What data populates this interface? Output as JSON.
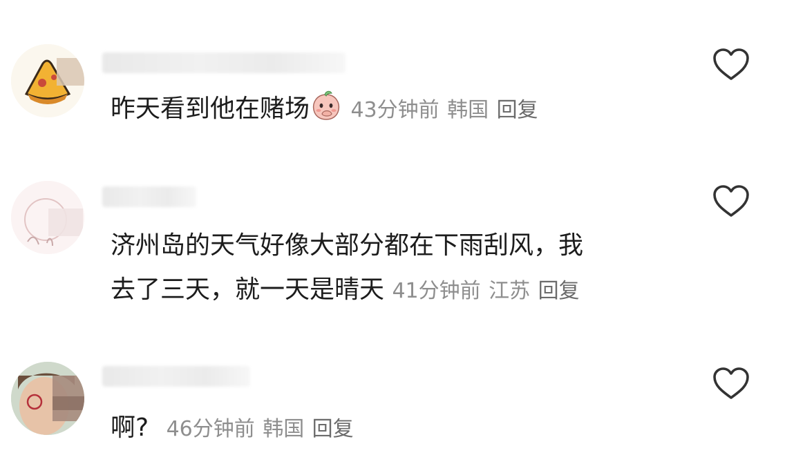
{
  "comments": [
    {
      "text": "昨天看到他在赌场",
      "emoji": "peach-covering-mouth-emoji",
      "time": "43分钟前",
      "location": "韩国",
      "reply_label": "回复",
      "like_icon": "heart-outline-icon"
    },
    {
      "text_line1": "济州岛的天气好像大部分都在下雨刮风，我",
      "text_line2": "去了三天，就一天是晴天",
      "time": "41分钟前",
      "location": "江苏",
      "reply_label": "回复",
      "like_icon": "heart-outline-icon"
    },
    {
      "text": "啊?",
      "time": "46分钟前",
      "location": "韩国",
      "reply_label": "回复",
      "like_icon": "heart-outline-icon"
    }
  ],
  "colors": {
    "text": "#1c1c1c",
    "meta": "#8e8e8e",
    "icon": "#333333"
  }
}
